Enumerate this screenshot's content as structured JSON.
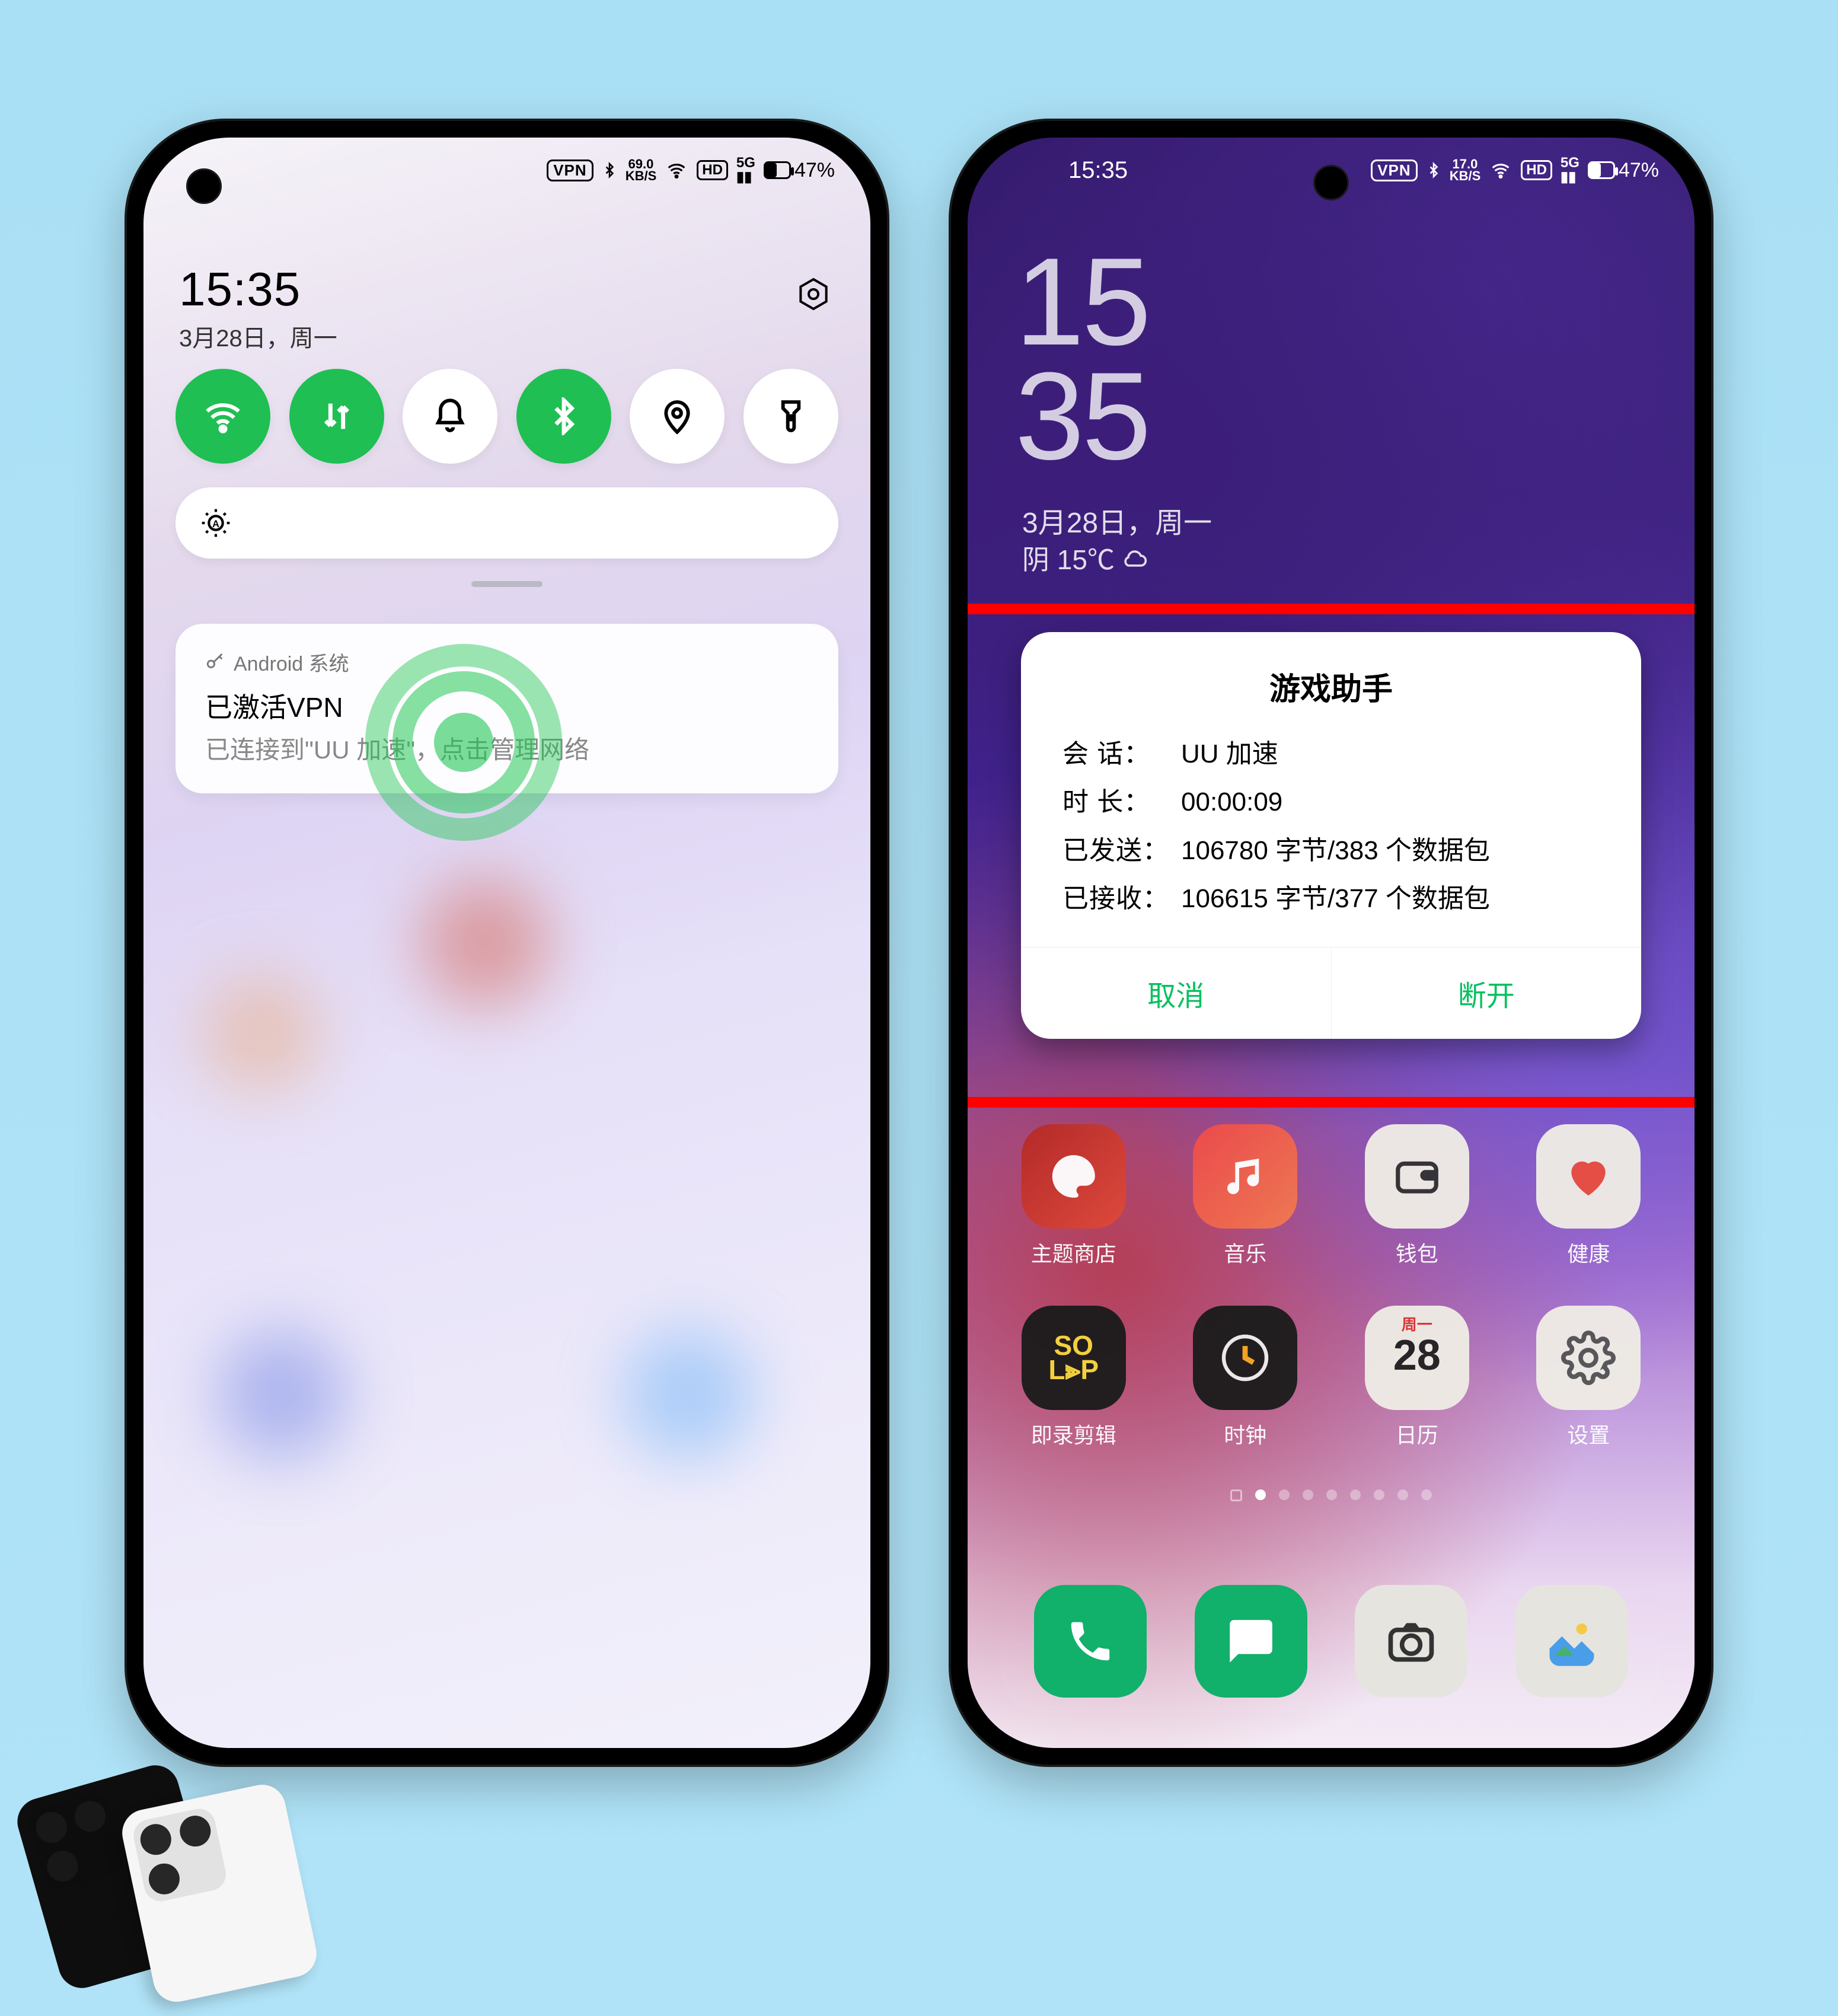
{
  "status": {
    "time": "15:35",
    "vpn": "VPN",
    "net": "17.0",
    "netUnit": "KB/S",
    "hd": "HD",
    "fiveG": "5G",
    "battery": "47%"
  },
  "leftStatus": {
    "net": "69.0",
    "netUnit": "KB/S"
  },
  "shade": {
    "time": "15:35",
    "date": "3月28日，周一",
    "qs": {
      "wifi": "wifi-icon",
      "data": "data-icon",
      "dnd": "bell-icon",
      "bt": "bluetooth-icon",
      "location": "location-icon",
      "torch": "flashlight-icon"
    }
  },
  "notif": {
    "app": "Android 系统",
    "title": "已激活VPN",
    "body": "已连接到\"UU 加速\"，点击管理网络"
  },
  "lock": {
    "hh": "15",
    "mm": "35",
    "date": "3月28日，周一",
    "weather": "阴 15℃"
  },
  "dialog": {
    "title": "游戏助手",
    "rows": {
      "sessionLabel": "会 话：",
      "sessionVal": "UU 加速",
      "durationLabel": "时 长：",
      "durationVal": "00:00:09",
      "sentLabel": "已发送：",
      "sentVal": "106780 字节/383 个数据包",
      "recvLabel": "已接收：",
      "recvVal": "106615 字节/377 个数据包"
    },
    "cancel": "取消",
    "disconnect": "断开"
  },
  "apps": {
    "theme": "主题商店",
    "music": "音乐",
    "wallet": "钱包",
    "health": "健康",
    "soloop": "即录剪辑",
    "clock": "时钟",
    "calendar": "日历",
    "settings": "设置",
    "calTop": "周一",
    "calDay": "28"
  }
}
